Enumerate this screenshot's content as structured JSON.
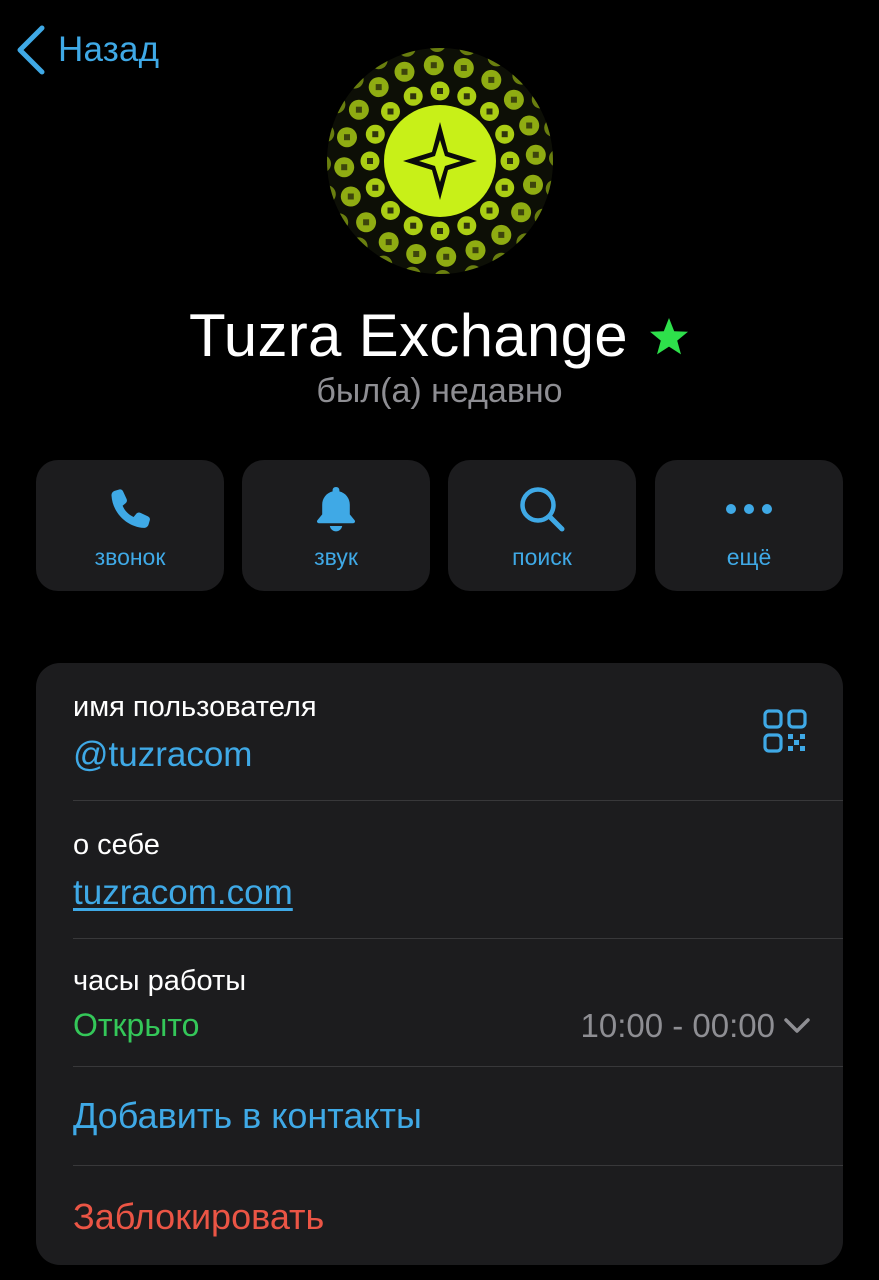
{
  "nav": {
    "back_label": "Назад"
  },
  "profile": {
    "name": "Tuzra Exchange",
    "status": "был(а) недавно",
    "badge_icon": "star-icon",
    "badge_color": "#2ee04b",
    "avatar_color": "#c8f018"
  },
  "actions": [
    {
      "label": "звонок",
      "icon": "phone-icon"
    },
    {
      "label": "звук",
      "icon": "bell-icon"
    },
    {
      "label": "поиск",
      "icon": "search-icon"
    },
    {
      "label": "ещё",
      "icon": "more-icon"
    }
  ],
  "info": {
    "username_label": "имя пользователя",
    "username_value": "@tuzracom",
    "about_label": "о себе",
    "about_value": "tuzracom.com",
    "hours_label": "часы работы",
    "hours_status": "Открыто",
    "hours_value": "10:00 - 00:00",
    "add_contact": "Добавить в контакты",
    "block": "Заблокировать"
  },
  "colors": {
    "accent": "#3fa9e6",
    "open": "#34c759",
    "destructive": "#eb5545",
    "card": "#1c1c1e"
  }
}
